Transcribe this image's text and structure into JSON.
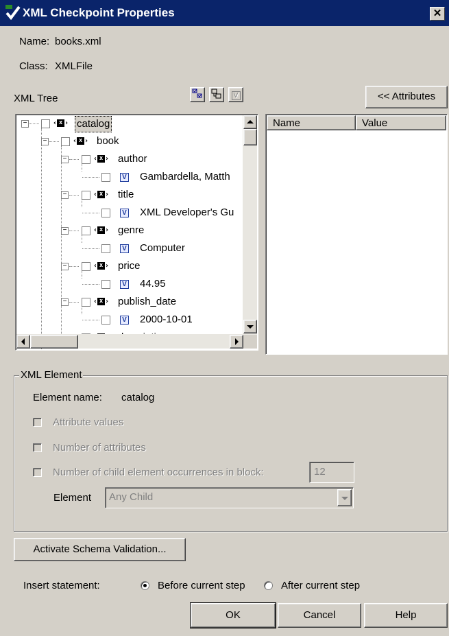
{
  "window": {
    "title": "XML Checkpoint Properties",
    "close_glyph": "✕"
  },
  "info": {
    "name_label": "Name:",
    "name_value": "books.xml",
    "class_label": "Class:",
    "class_value": "XMLFile"
  },
  "tree_panel": {
    "label": "XML Tree",
    "attributes_button": "<< Attributes",
    "toolbar_icons": [
      "check-all-icon",
      "collapse-tree-icon",
      "value-icon"
    ],
    "value_glyph": "V",
    "nodes": [
      {
        "label": "catalog",
        "type": "element",
        "selected": true
      },
      {
        "label": "book",
        "type": "element"
      },
      {
        "label": "author",
        "type": "element"
      },
      {
        "label": "Gambardella, Matth",
        "type": "value"
      },
      {
        "label": "title",
        "type": "element"
      },
      {
        "label": "XML Developer's Gu",
        "type": "value"
      },
      {
        "label": "genre",
        "type": "element"
      },
      {
        "label": "Computer",
        "type": "value"
      },
      {
        "label": "price",
        "type": "element"
      },
      {
        "label": "44.95",
        "type": "value"
      },
      {
        "label": "publish_date",
        "type": "element"
      },
      {
        "label": "2000-10-01",
        "type": "value"
      },
      {
        "label": "description",
        "type": "element"
      }
    ]
  },
  "attributes": {
    "columns": [
      "Name",
      "Value"
    ]
  },
  "xml_element": {
    "group_title": "XML Element",
    "element_name_label": "Element name:",
    "element_name_value": "catalog",
    "attr_values_label": "Attribute values",
    "num_attrs_label": "Number of attributes",
    "child_occ_label": "Number of child element occurrences in block:",
    "child_occ_value": "12",
    "element_label": "Element",
    "element_select_value": "Any Child"
  },
  "schema_button": "Activate Schema Validation...",
  "insert": {
    "label": "Insert statement:",
    "before": "Before current step",
    "after": "After current step",
    "selected": "before"
  },
  "buttons": {
    "ok": "OK",
    "cancel": "Cancel",
    "help": "Help"
  },
  "colors": {
    "titlebar": "#0a246a",
    "face": "#d4d0c8",
    "value_icon": "#1c3a9c"
  }
}
